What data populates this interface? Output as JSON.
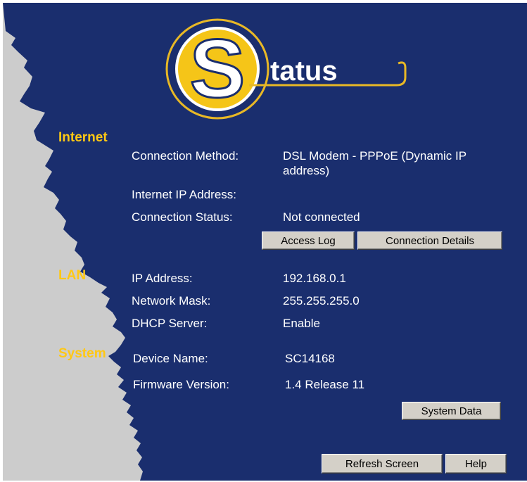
{
  "header": {
    "logo_letter": "S",
    "logo_text": "tatus"
  },
  "internet": {
    "title": "Internet",
    "connection_method_label": "Connection Method:",
    "connection_method_value": "DSL Modem - PPPoE (Dynamic IP address)",
    "ip_label": "Internet IP Address:",
    "ip_value": "",
    "status_label": "Connection Status:",
    "status_value": "Not connected",
    "access_log_button": "Access Log",
    "connection_details_button": "Connection Details"
  },
  "lan": {
    "title": "LAN",
    "ip_label": "IP Address:",
    "ip_value": "192.168.0.1",
    "mask_label": "Network Mask:",
    "mask_value": "255.255.255.0",
    "dhcp_label": "DHCP Server:",
    "dhcp_value": "Enable"
  },
  "system": {
    "title": "System",
    "device_label": "Device Name:",
    "device_value": "SC14168",
    "firmware_label": "Firmware Version:",
    "firmware_value": "1.4 Release 11",
    "system_data_button": "System Data"
  },
  "footer": {
    "refresh_button": "Refresh Screen",
    "help_button": "Help"
  },
  "colors": {
    "background": "#1a2e6e",
    "heading": "#ffc814",
    "text": "#ffffff",
    "button": "#d4d0c8",
    "torn_edge": "#cccccc"
  }
}
